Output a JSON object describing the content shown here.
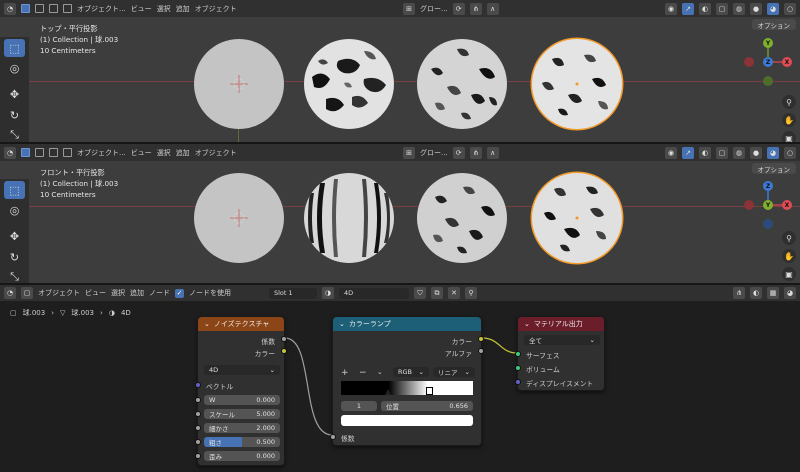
{
  "header_top": {
    "mode": "オブジェクト...",
    "menus": [
      "ビュー",
      "選択",
      "追加",
      "オブジェクト"
    ],
    "transform_orientation": "グロー..."
  },
  "viewport_top": {
    "view_name": "トップ・平行投影",
    "collection": "(1) Collection | 球.003",
    "scale": "10 Centimeters",
    "options": "オプション"
  },
  "header_mid": {
    "mode": "オブジェクト...",
    "menus": [
      "ビュー",
      "選択",
      "追加",
      "オブジェクト"
    ],
    "transform_orientation": "グロー..."
  },
  "viewport_front": {
    "view_name": "フロント・平行投影",
    "collection": "(1) Collection | 球.003",
    "scale": "10 Centimeters",
    "options": "オプション"
  },
  "node_header": {
    "mode": "オブジェクト",
    "menus": [
      "ビュー",
      "選択",
      "追加",
      "ノード"
    ],
    "use_nodes_label": "ノードを使用",
    "slot": "Slot 1",
    "material": "4D"
  },
  "breadcrumb": [
    "球.003",
    "球.003",
    "4D"
  ],
  "gizmo_axes": {
    "y": "Y",
    "z": "Z",
    "x": "X"
  },
  "nodes": {
    "noise": {
      "title": "ノイズテクスチャ",
      "out_fac": "係数",
      "out_color": "カラー",
      "dimension": "4D",
      "in_vector": "ベクトル",
      "fields": [
        {
          "label": "W",
          "value": "0.000"
        },
        {
          "label": "スケール",
          "value": "5.000"
        },
        {
          "label": "細かさ",
          "value": "2.000"
        },
        {
          "label": "粗さ",
          "value": "0.500"
        },
        {
          "label": "歪み",
          "value": "0.000"
        }
      ]
    },
    "ramp": {
      "title": "カラーランプ",
      "out_color": "カラー",
      "out_alpha": "アルファ",
      "color_mode": "RGB",
      "interp": "リニア",
      "stop_index": "1",
      "pos_label": "位置",
      "pos_value": "0.656",
      "in_fac": "係数"
    },
    "output": {
      "title": "マテリアル出力",
      "target": "全て",
      "in_surface": "サーフェス",
      "in_volume": "ボリューム",
      "in_displacement": "ディスプレイスメント"
    }
  },
  "colors": {
    "accent": "#4772b3",
    "noise_header": "#8b4516",
    "ramp_header": "#1d5f76",
    "output_header": "#6b1d2a",
    "selection": "#f29a2a"
  }
}
